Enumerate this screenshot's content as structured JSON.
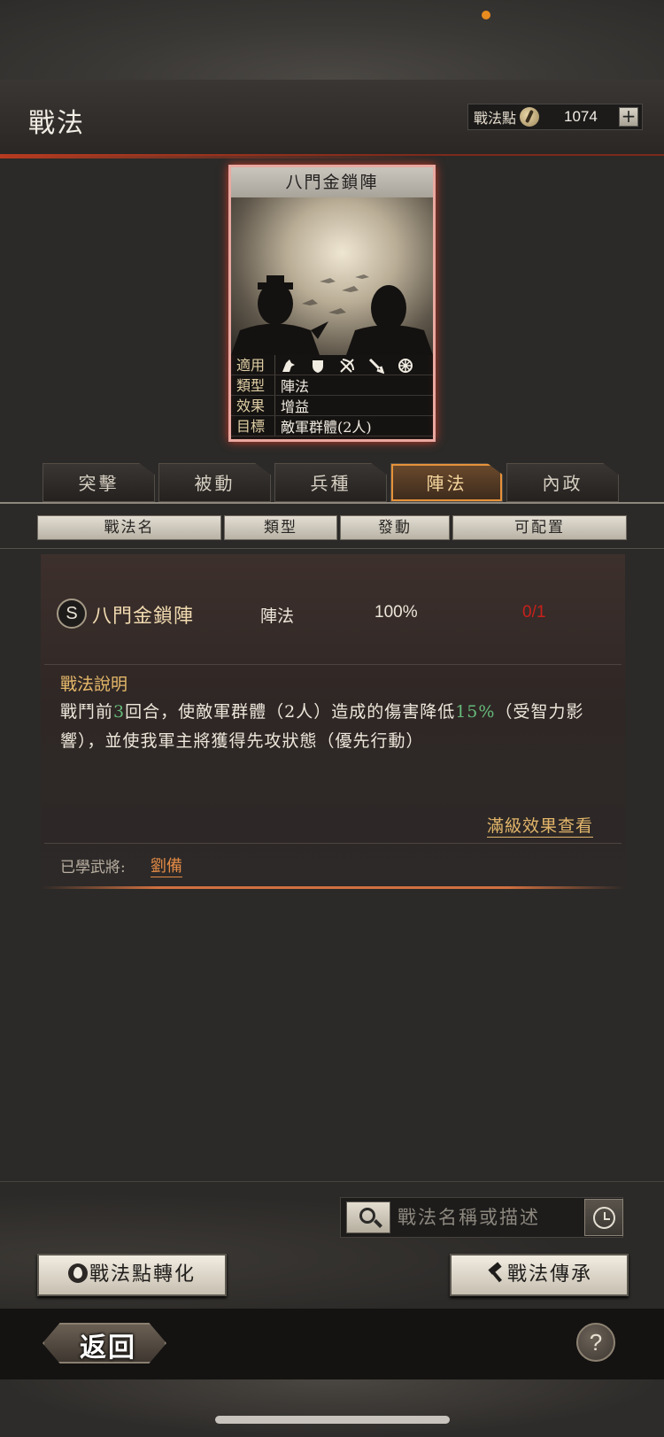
{
  "header": {
    "title": "戰法",
    "points_label": "戰法點",
    "points_value": "1074",
    "plus_label": "+"
  },
  "card": {
    "title": "八門金鎖陣",
    "rows": [
      {
        "key": "適用",
        "value": ""
      },
      {
        "key": "類型",
        "value": "陣法"
      },
      {
        "key": "效果",
        "value": "增益"
      },
      {
        "key": "目標",
        "value": "敵軍群體(2人)"
      }
    ],
    "unit_icons": [
      "cavalry-icon",
      "shield-icon",
      "bow-icon",
      "spear-icon",
      "wheel-icon"
    ]
  },
  "tabs": [
    "突擊",
    "被動",
    "兵種",
    "陣法",
    "內政"
  ],
  "active_tab": 3,
  "columns": [
    "戰法名",
    "類型",
    "發動",
    "可配置"
  ],
  "skill": {
    "grade": "S",
    "name": "八門金鎖陣",
    "type": "陣法",
    "trigger": "100%",
    "slots": "0/1",
    "desc_title": "戰法說明",
    "desc_part1": "戰鬥前",
    "desc_num1": "3",
    "desc_part2": "回合，使敵軍群體（2人）造成的傷害降低",
    "desc_num2": "15%",
    "desc_part3": "（受智力影響），並使我軍主將獲得先攻狀態（優先行動）",
    "max_effect_link": "滿級效果查看",
    "learned_label": "已學武將:",
    "learned_general": "劉備"
  },
  "search": {
    "placeholder": "戰法名稱或描述"
  },
  "buttons": {
    "convert": "戰法點轉化",
    "inherit": "戰法傳承",
    "back": "返回",
    "help": "?"
  },
  "colors": {
    "accent": "#e6923a",
    "slot_red": "#c8201b",
    "highlight_green": "#66b97a",
    "gold_text": "#e6b96a"
  }
}
